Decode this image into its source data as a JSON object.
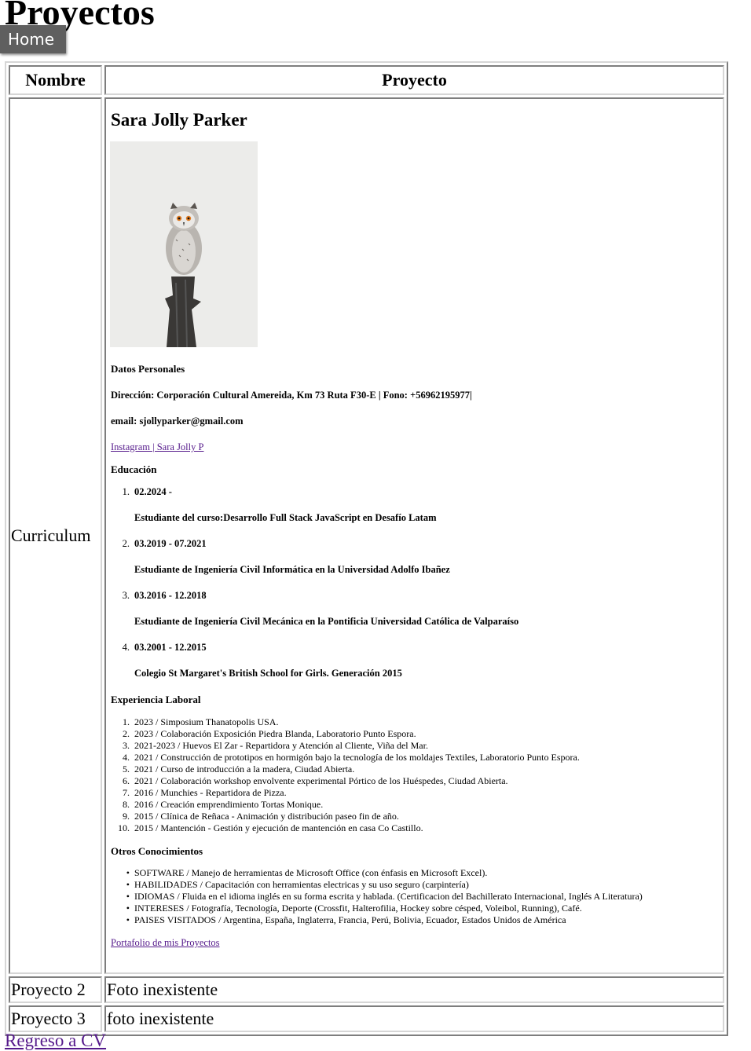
{
  "page": {
    "title": "Proyectos",
    "home_button": "Home",
    "back_link": "Regreso a CV"
  },
  "table": {
    "headers": [
      "Nombre",
      "Proyecto"
    ],
    "rows": [
      {
        "name": "Curriculum"
      },
      {
        "name": "Proyecto 2",
        "project": "Foto inexistente"
      },
      {
        "name": "Proyecto 3",
        "project": "foto inexistente"
      }
    ]
  },
  "cv": {
    "name": "Sara Jolly Parker",
    "personal_heading": "Datos Personales",
    "address": "Dirección: Corporación Cultural Amereida, Km 73 Ruta F30-E | Fono: +56962195977|",
    "email": "email: sjollyparker@gmail.com",
    "instagram": "Instagram | Sara Jolly P",
    "education_heading": "Educación",
    "education": [
      {
        "date": "02.2024 -",
        "desc": "Estudiante del curso:Desarrollo Full Stack JavaScript en Desafío Latam"
      },
      {
        "date": "03.2019 - 07.2021",
        "desc": "Estudiante de Ingeniería Civil Informática en la Universidad Adolfo Ibañez"
      },
      {
        "date": "03.2016 - 12.2018",
        "desc": "Estudiante de Ingeniería Civil Mecánica en la Pontificia Universidad Católica de Valparaíso"
      },
      {
        "date": "03.2001 - 12.2015",
        "desc": "Colegio St Margaret's British School for Girls. Generación 2015"
      }
    ],
    "experience_heading": "Experiencia Laboral",
    "experience": [
      "2023 / Simposium Thanatopolis USA.",
      "2023 / Colaboración Exposición Piedra Blanda, Laboratorio Punto Espora.",
      "2021-2023 / Huevos El Zar - Repartidora y Atención al Cliente, Viña del Mar.",
      "2021 / Construcción de prototipos en hormigón bajo la tecnología de los moldajes Textiles, Laboratorio Punto Espora.",
      "2021 / Curso de introducción a la madera, Ciudad Abierta.",
      "2021 / Colaboración workshop envolvente experimental Pórtico de los Huéspedes, Ciudad Abierta.",
      "2016 / Munchies - Repartidora de Pizza.",
      "2016 / Creación emprendimiento Tortas Monique.",
      "2015 / Clínica de Reñaca - Animación y distribución paseo fin de año.",
      "2015 / Mantención - Gestión y ejecución de mantención en casa Co Castillo."
    ],
    "other_heading": "Otros Conocimientos",
    "other": [
      "SOFTWARE / Manejo de herramientas de Microsoft Office (con énfasis en Microsoft Excel).",
      "HABILIDADES / Capacitación con herramientas electricas y su uso seguro (carpintería)",
      "IDIOMAS / Fluida en el idioma inglés en su forma escrita y hablada. (Certificacion del Bachillerato Internacional, Inglés A Literatura)",
      "INTERESES / Fotografía, Tecnología, Deporte (Crossfit, Halterofilia, Hockey sobre césped, Voleibol, Running), Café.",
      "PAISES VISITADOS / Argentina, España, Inglaterra, Francia, Perú, Bolivia, Ecuador, Estados Unidos de América"
    ],
    "portfolio_link": "Portafolio de mis Proyectos"
  }
}
